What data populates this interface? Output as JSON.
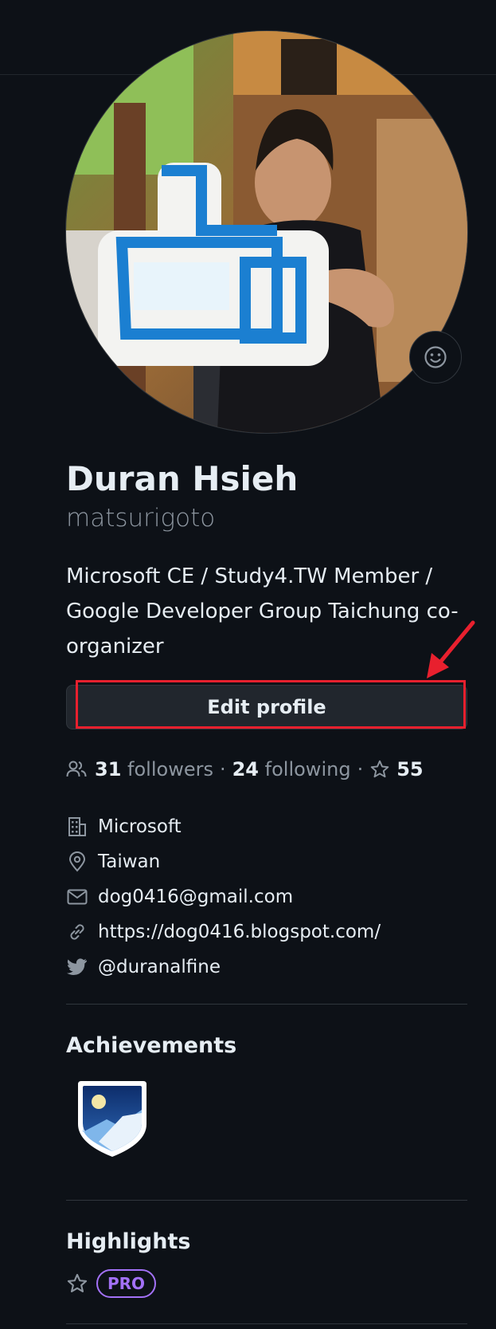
{
  "profile": {
    "name": "Duran Hsieh",
    "login": "matsurigoto",
    "bio": "Microsoft CE / Study4.TW Member / Google Developer Group Taichung co-organizer",
    "edit_label": "Edit profile"
  },
  "stats": {
    "followers_count": "31",
    "followers_label": "followers",
    "following_count": "24",
    "following_label": "following",
    "stars_count": "55",
    "separator": "·"
  },
  "details": {
    "company": "Microsoft",
    "location": "Taiwan",
    "email": "dog0416@gmail.com",
    "website": "https://dog0416.blogspot.com/",
    "twitter": "@duranalfine"
  },
  "sections": {
    "achievements_title": "Achievements",
    "highlights_title": "Highlights",
    "pro_badge": "PRO"
  },
  "colors": {
    "background": "#0d1117",
    "annotation": "#e8202e",
    "pro": "#a371f7"
  }
}
